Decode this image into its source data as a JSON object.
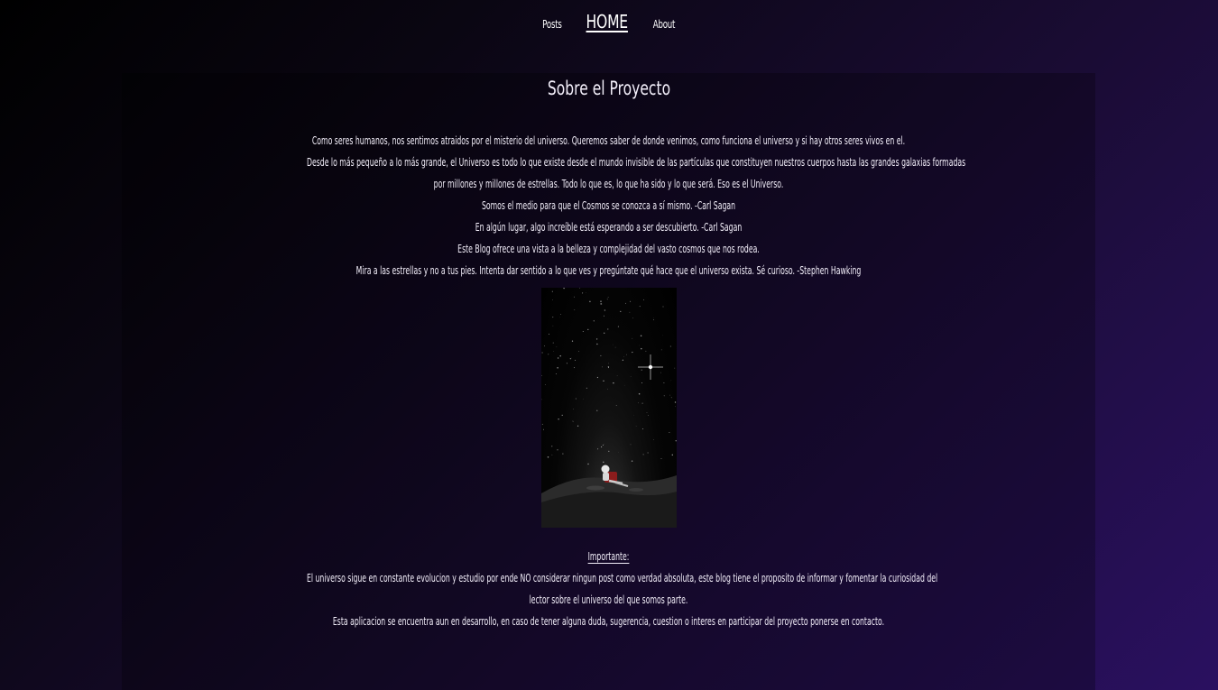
{
  "nav": {
    "posts": "Posts",
    "home": "HOME",
    "about": "About"
  },
  "page": {
    "title": "Sobre el Proyecto",
    "intro_lines": [
      "Como seres humanos, nos sentimos atraidos por el misterio del universo. Queremos saber de donde venimos, como funciona el universo y si hay otros seres vivos en el.",
      "Desde lo más pequeño a lo más grande, el Universo es todo lo que existe desde el mundo invisible de las partículas que constituyen nuestros cuerpos hasta las grandes galaxias formadas",
      "por millones y millones de estrellas. Todo lo que es, lo que ha sido y lo que será. Eso es el Universo.",
      "Somos el medio para que el Cosmos se conozca a sí mismo. -Carl Sagan",
      "En algún lugar, algo increíble está esperando a ser descubierto. -Carl Sagan",
      "Este Blog ofrece una vista a la belleza y complejidad del vasto cosmos que nos rodea.",
      "Mira a las estrellas y no a tus pies. Intenta dar sentido a lo que ves y pregúntate qué hace que el universo exista. Sé curioso. -Stephen Hawking"
    ],
    "image_subject": "astronaut-on-moon-starfield",
    "important_heading": "Importante:",
    "important_lines": [
      "El universo sigue en constante evolucion y estudio por ende NO considerar ningun post como verdad absoluta, este blog tiene el proposito de informar y fomentar la curiosidad del",
      "lector sobre el universo del que somos parte.",
      "Esta aplicacion se encuentra aun en desarrollo, en caso de tener alguna duda, sugerencia, cuestion o interes en participar del proyecto ponerse en contacto."
    ]
  },
  "colors": {
    "background_dark": "#000000",
    "background_purple": "#2a1060",
    "text": "#f3effa"
  }
}
